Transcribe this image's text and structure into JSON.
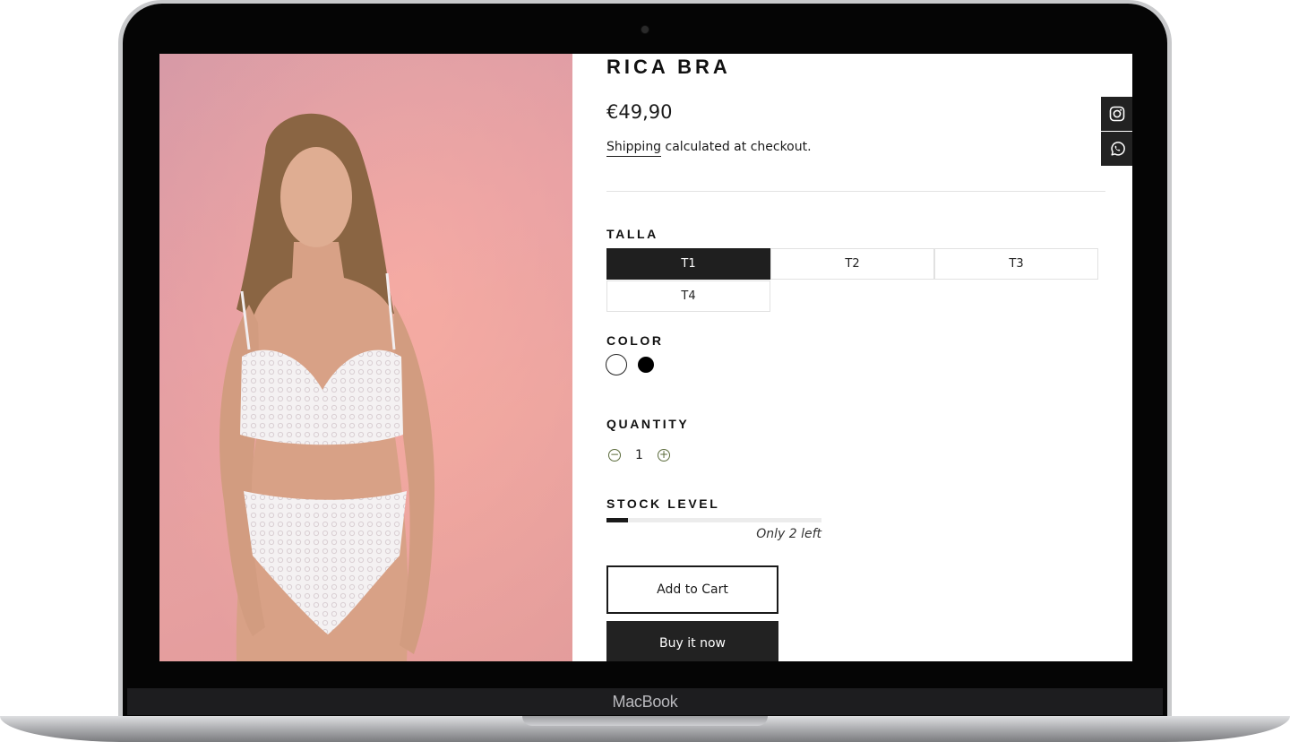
{
  "device": {
    "label": "MacBook"
  },
  "product": {
    "title": "RICA BRA",
    "price": "€49,90",
    "shipping_link": "Shipping",
    "shipping_suffix": " calculated at checkout."
  },
  "size": {
    "label": "TALLA",
    "options": [
      "T1",
      "T2",
      "T3",
      "T4"
    ],
    "selected": "T1"
  },
  "color": {
    "label": "COLOR",
    "options": [
      {
        "name": "white",
        "hex": "#ffffff"
      },
      {
        "name": "black",
        "hex": "#000000"
      }
    ]
  },
  "quantity": {
    "label": "QUANTITY",
    "minus_icon": "minus-circle-icon",
    "plus_icon": "plus-circle-icon",
    "value": "1"
  },
  "stock": {
    "label": "STOCK LEVEL",
    "fill_fraction": 0.1,
    "text": "Only 2 left"
  },
  "actions": {
    "add_to_cart": "Add to Cart",
    "buy_now": "Buy it now"
  },
  "social": {
    "icons": [
      "instagram-icon",
      "whatsapp-icon"
    ]
  }
}
